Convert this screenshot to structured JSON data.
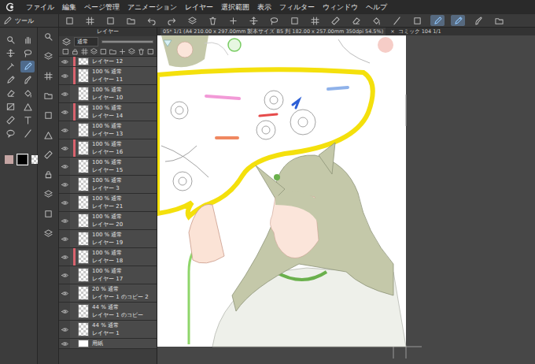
{
  "menu": [
    "ファイル",
    "編集",
    "ページ管理",
    "アニメーション",
    "レイヤー",
    "選択範囲",
    "表示",
    "フィルター",
    "ウィンドウ",
    "ヘルプ"
  ],
  "toolbar": {
    "toggles": [
      {
        "selected": false
      },
      {
        "selected": false
      },
      {
        "selected": false
      },
      {
        "selected": false
      },
      {
        "selected": false
      },
      {
        "selected": false
      },
      {
        "selected": false
      },
      {
        "selected": false
      },
      {
        "selected": false
      },
      {
        "selected": false
      },
      {
        "selected": false
      },
      {
        "selected": false
      },
      {
        "selected": false
      },
      {
        "selected": false
      },
      {
        "selected": false
      },
      {
        "selected": false
      },
      {
        "selected": false
      },
      {
        "selected": false
      },
      {
        "selected": true
      },
      {
        "selected": true
      },
      {
        "selected": false
      },
      {
        "selected": false
      }
    ]
  },
  "tool_panel": {
    "tab": "ツール",
    "tools": [
      {
        "selected": false
      },
      {
        "selected": false
      },
      {
        "selected": false
      },
      {
        "selected": false
      },
      {
        "selected": false
      },
      {
        "selected": true
      },
      {
        "selected": false
      },
      {
        "selected": false
      },
      {
        "selected": false
      },
      {
        "selected": false
      },
      {
        "selected": false
      },
      {
        "selected": false
      },
      {
        "selected": false
      },
      {
        "selected": false
      },
      {
        "selected": false
      },
      {
        "selected": false
      }
    ],
    "swatches": [
      {
        "kind": "color",
        "color": "#c5a5a3",
        "selected": false
      },
      {
        "kind": "color",
        "color": "#000000",
        "selected": true
      },
      {
        "kind": "clear",
        "selected": false
      }
    ]
  },
  "layer_panel": {
    "title": "レイヤー",
    "blend_mode": "通常",
    "opacity_slider": {
      "level": 1
    },
    "layers": [
      {
        "name": "レイヤー 12",
        "visible": true,
        "marked": true,
        "kind": "raster"
      },
      {
        "status": "100 % 通常",
        "name": "レイヤー 11",
        "visible": true,
        "marked": true,
        "kind": "raster"
      },
      {
        "status": "100 % 通常",
        "name": "レイヤー 10",
        "visible": true,
        "marked": false,
        "kind": "raster"
      },
      {
        "status": "100 % 通常",
        "name": "レイヤー 14",
        "visible": true,
        "marked": true,
        "kind": "raster"
      },
      {
        "status": "100 % 通常",
        "name": "レイヤー 13",
        "visible": true,
        "marked": false,
        "kind": "raster"
      },
      {
        "status": "100 % 通常",
        "name": "レイヤー 16",
        "visible": true,
        "marked": true,
        "kind": "raster"
      },
      {
        "status": "100 % 通常",
        "name": "レイヤー 15",
        "visible": true,
        "marked": false,
        "kind": "raster"
      },
      {
        "status": "100 % 通常",
        "name": "レイヤー 3",
        "visible": true,
        "marked": false,
        "kind": "raster"
      },
      {
        "status": "100 % 通常",
        "name": "レイヤー 21",
        "visible": true,
        "marked": false,
        "kind": "raster"
      },
      {
        "status": "100 % 通常",
        "name": "レイヤー 20",
        "visible": true,
        "marked": false,
        "kind": "raster"
      },
      {
        "status": "100 % 通常",
        "name": "レイヤー 19",
        "visible": true,
        "marked": false,
        "kind": "raster"
      },
      {
        "status": "100 % 通常",
        "name": "レイヤー 18",
        "visible": true,
        "marked": true,
        "kind": "raster"
      },
      {
        "status": "100 % 通常",
        "name": "レイヤー 17",
        "visible": true,
        "marked": false,
        "kind": "raster"
      },
      {
        "status": "20 % 通常",
        "name": "レイヤー 1 のコピー 2",
        "visible": true,
        "marked": false,
        "kind": "raster"
      },
      {
        "status": "44 % 通常",
        "name": "レイヤー 1 のコピー",
        "visible": true,
        "marked": false,
        "kind": "raster"
      },
      {
        "status": "44 % 通常",
        "name": "レイヤー 1",
        "visible": true,
        "marked": false,
        "kind": "raster"
      },
      {
        "name": "用紙",
        "visible": true,
        "marked": false,
        "kind": "paper"
      }
    ]
  },
  "document": {
    "tab": "05* 1/1 (A4 210.00 x 297.00mm 製本サイズ B5 判 182.00 x 257.00mm 350dpi 54.5%)",
    "close": "×",
    "next_tab": "コミック 104 1/1"
  }
}
